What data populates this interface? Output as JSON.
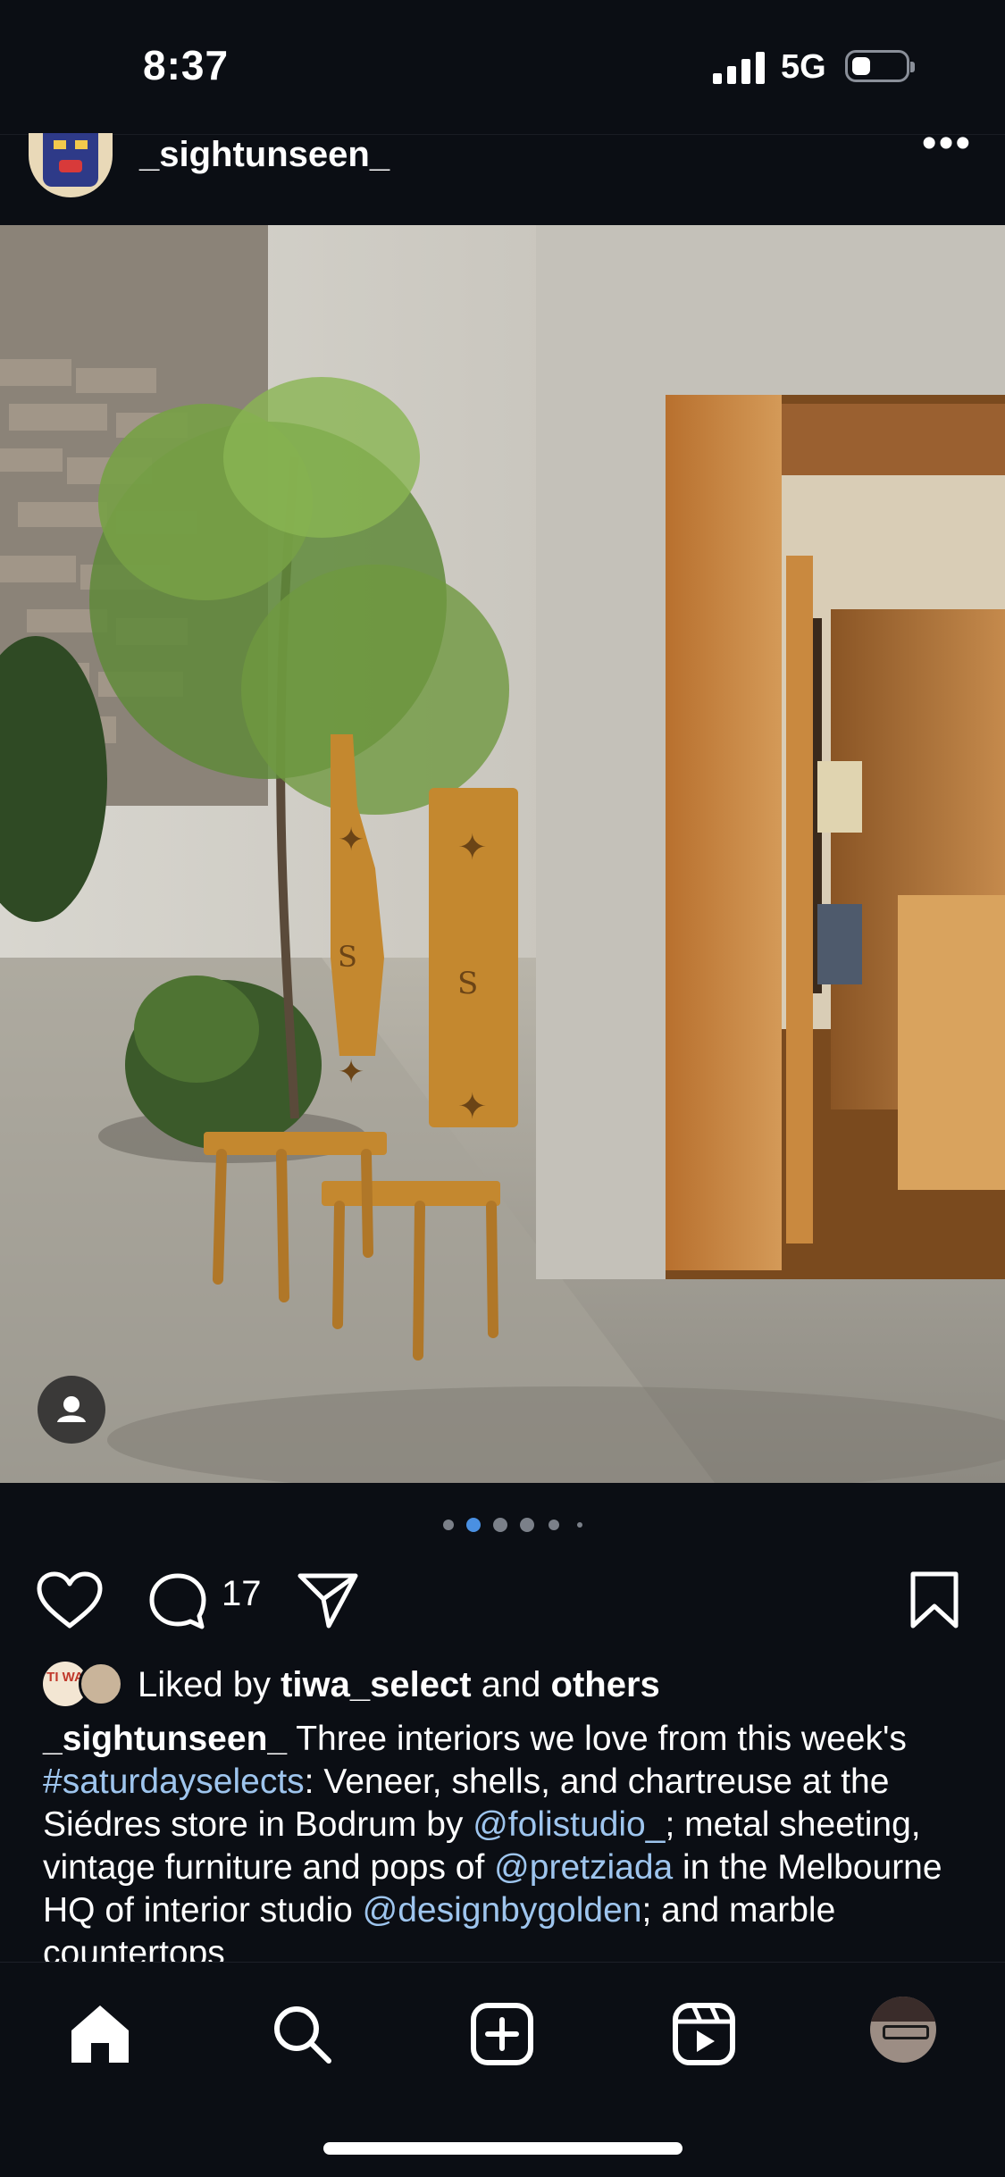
{
  "status_bar": {
    "time": "8:37",
    "network": "5G"
  },
  "post": {
    "username": "_sightunseen_",
    "more_label": "•••",
    "comment_count": "17",
    "carousel": {
      "current": 2,
      "total": 6,
      "active_color": "#4a90e2"
    },
    "likes": {
      "prefix": "Liked by ",
      "user": "tiwa_select",
      "middle": " and ",
      "others": "others",
      "avatar_text": "TI WA"
    },
    "caption": {
      "username": "_sightunseen_",
      "parts": [
        {
          "t": " Three interiors we love from this week's ",
          "link": false
        },
        {
          "t": "#saturdayselects",
          "link": true
        },
        {
          "t": ": Veneer, shells, and chartreuse at the Siédres store in Bodrum by ",
          "link": false
        },
        {
          "t": "@folistudio_",
          "link": true
        },
        {
          "t": "; metal sheeting, vintage furniture and pops of ",
          "link": false
        },
        {
          "t": "@pretziada",
          "link": true
        },
        {
          "t": " in the Melbourne HQ of interior studio ",
          "link": false
        },
        {
          "t": "@designbygolden",
          "link": true
        },
        {
          "t": "; and marble countertops",
          "link": false
        }
      ]
    }
  },
  "tabs": [
    "home",
    "search",
    "create",
    "reels",
    "profile"
  ],
  "icons": [
    "signal-icon",
    "battery-icon",
    "heart-icon",
    "comment-icon",
    "share-icon",
    "bookmark-icon",
    "tag-person-icon",
    "home-icon",
    "search-icon",
    "plus-square-icon",
    "reels-icon"
  ],
  "colors": {
    "background": "#0b0e14",
    "link": "#9ec5ee",
    "text": "#ffffff"
  }
}
